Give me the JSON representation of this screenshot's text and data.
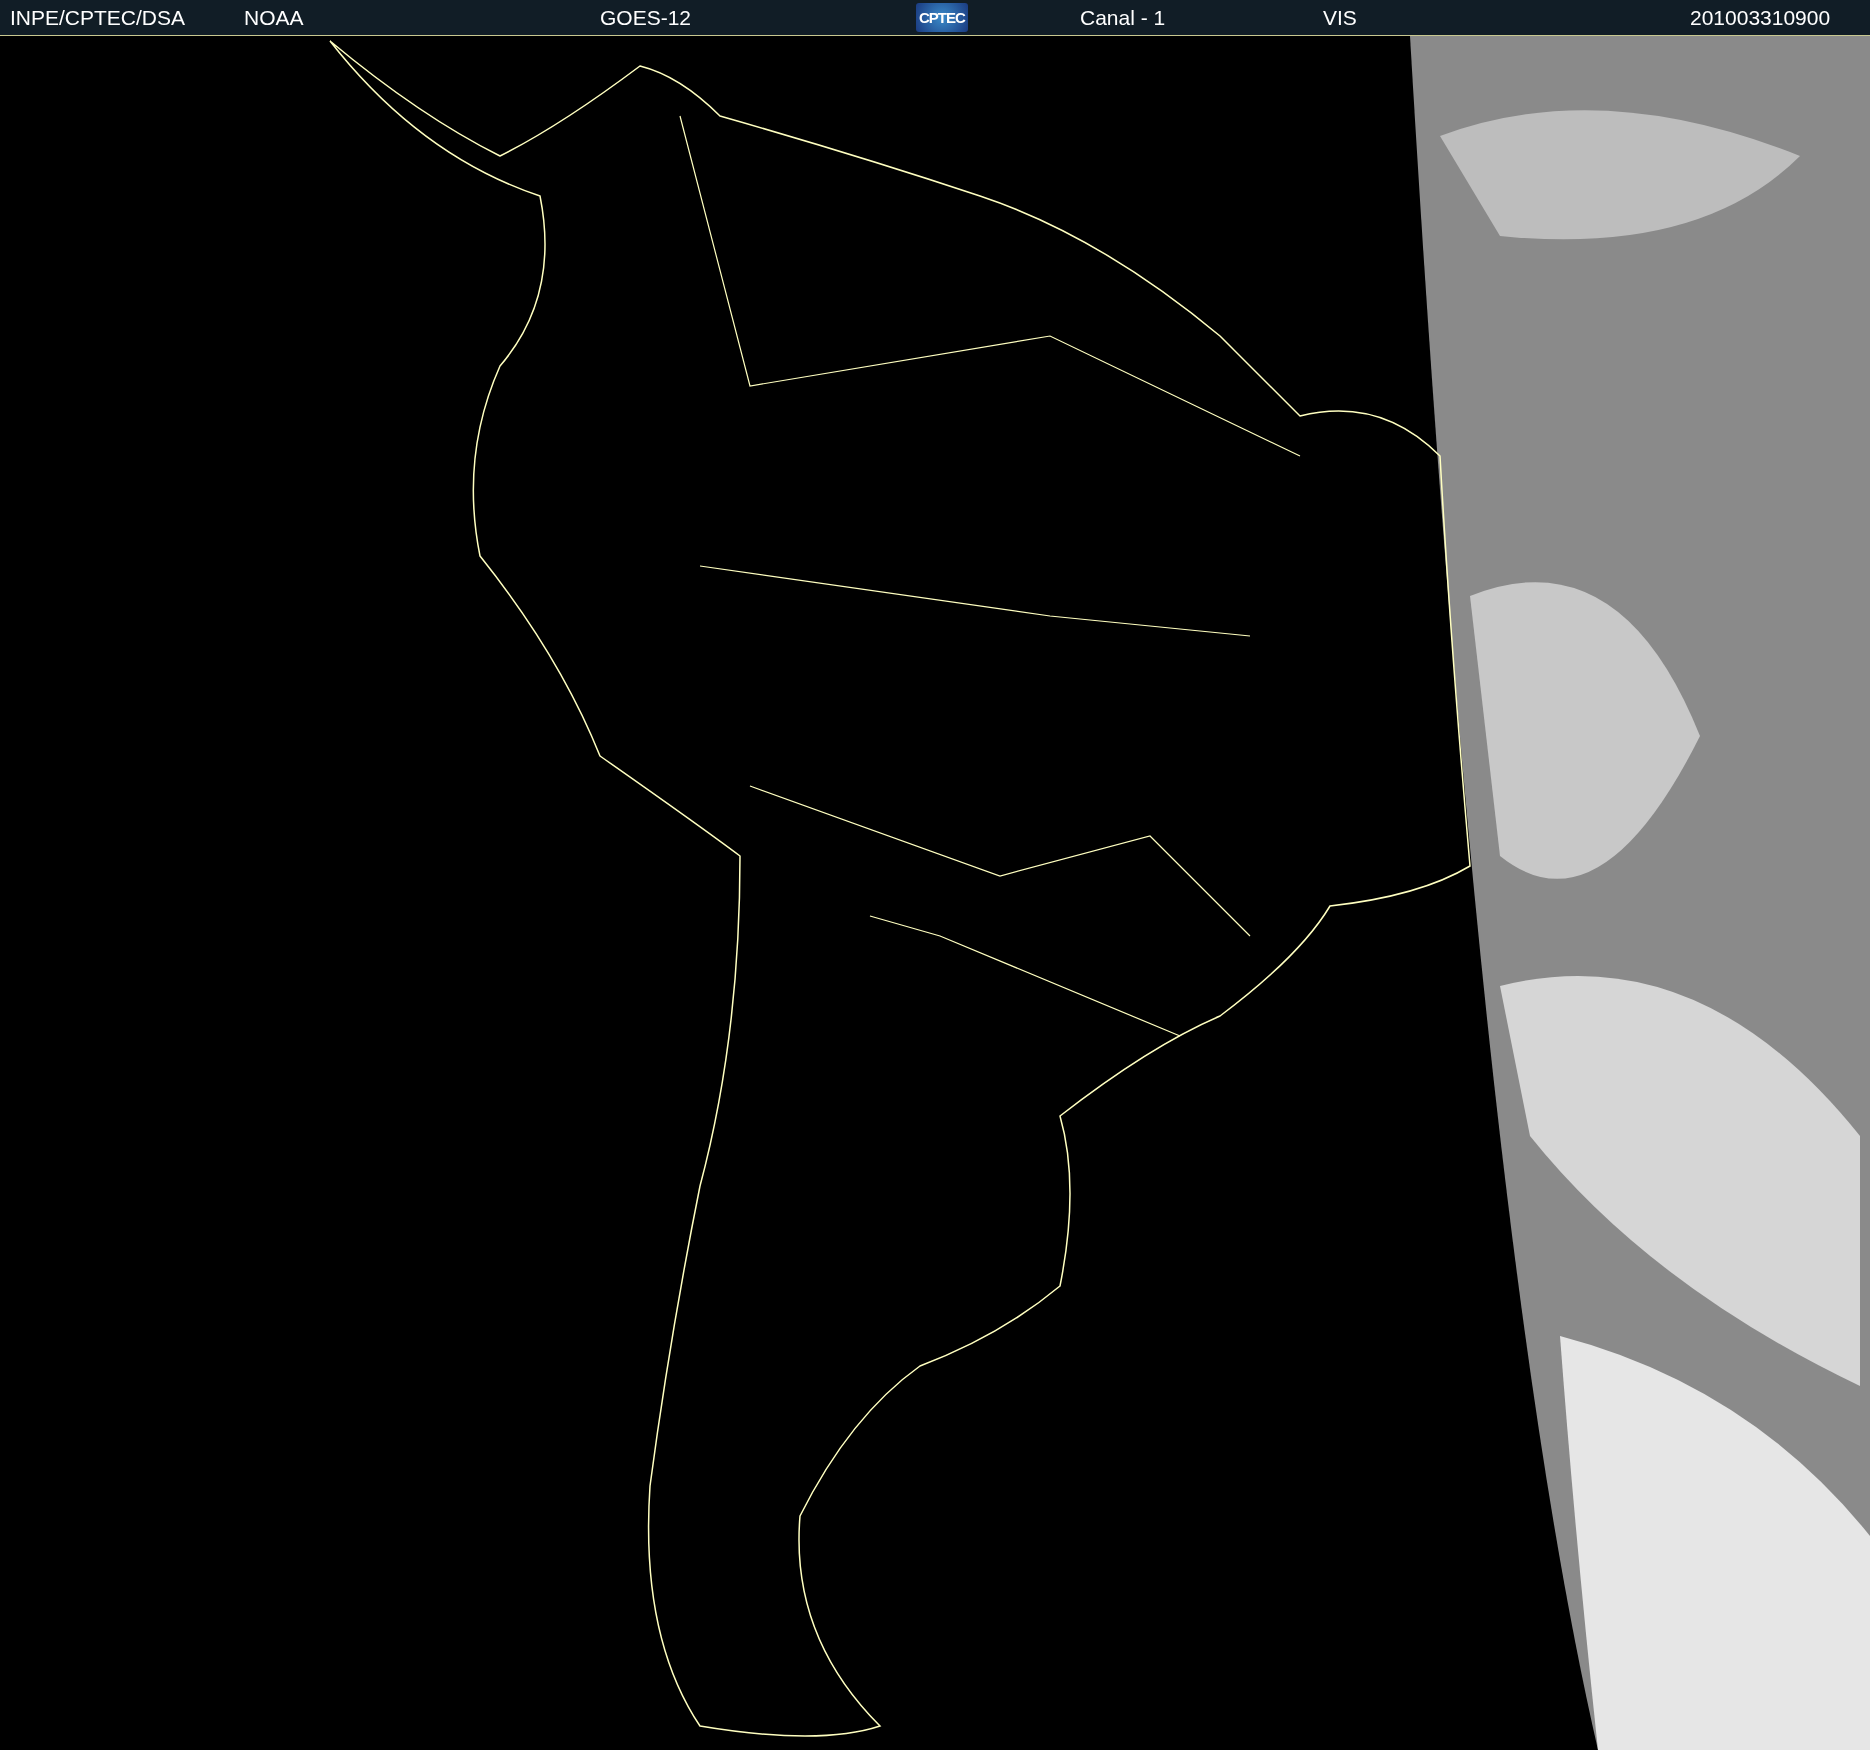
{
  "header": {
    "items": [
      {
        "kind": "text",
        "text": "INPE/CPTEC/DSA"
      },
      {
        "kind": "text",
        "text": "NOAA"
      },
      {
        "kind": "text",
        "text": "GOES-12"
      },
      {
        "kind": "logo",
        "text": "CPTEC"
      },
      {
        "kind": "text",
        "text": "Canal - 1"
      },
      {
        "kind": "text",
        "text": "VIS"
      },
      {
        "kind": "text",
        "text": "201003310900"
      }
    ]
  }
}
